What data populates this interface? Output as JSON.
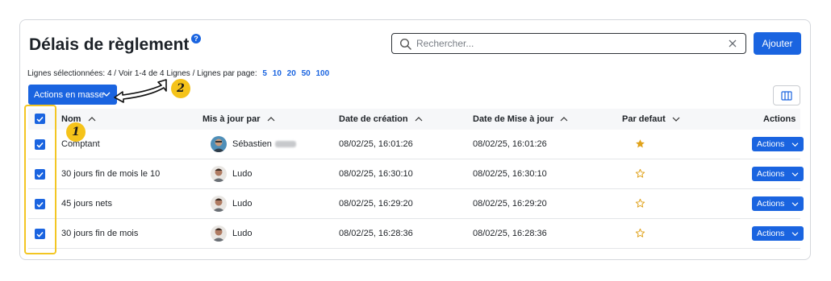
{
  "header": {
    "title": "Délais de règlement",
    "help_glyph": "?",
    "search_placeholder": "Rechercher...",
    "add_label": "Ajouter"
  },
  "info": {
    "selected": "Lignes sélectionnées: 4 /  Voir 1-4 de 4 Lignes /  Lignes par page:",
    "per_page_options": [
      "5",
      "10",
      "20",
      "50",
      "100"
    ]
  },
  "toolbar": {
    "mass_actions_label": "Actions en masse",
    "columns_icon": "columns-icon"
  },
  "table": {
    "columns": [
      "Nom",
      "Mis à jour par",
      "Date de création",
      "Date de Mise à jour",
      "Par defaut",
      "Actions"
    ],
    "rows": [
      {
        "nom": "Comptant",
        "user": "Sébastien",
        "created": "08/02/25, 16:01:26",
        "updated": "08/02/25, 16:01:26",
        "default": true,
        "action_label": "Actions"
      },
      {
        "nom": "30 jours fin de mois le 10",
        "user": "Ludo",
        "created": "08/02/25, 16:30:10",
        "updated": "08/02/25, 16:30:10",
        "default": false,
        "action_label": "Actions"
      },
      {
        "nom": "45 jours nets",
        "user": "Ludo",
        "created": "08/02/25, 16:29:20",
        "updated": "08/02/25, 16:29:20",
        "default": false,
        "action_label": "Actions"
      },
      {
        "nom": "30 jours fin de mois",
        "user": "Ludo",
        "created": "08/02/25, 16:28:36",
        "updated": "08/02/25, 16:28:36",
        "default": false,
        "action_label": "Actions"
      }
    ]
  },
  "annotations": {
    "badge_1": "1",
    "badge_2": "2"
  },
  "colors": {
    "accent": "#1a64e0",
    "highlight": "#f3c623",
    "star": "#e0a21b"
  }
}
